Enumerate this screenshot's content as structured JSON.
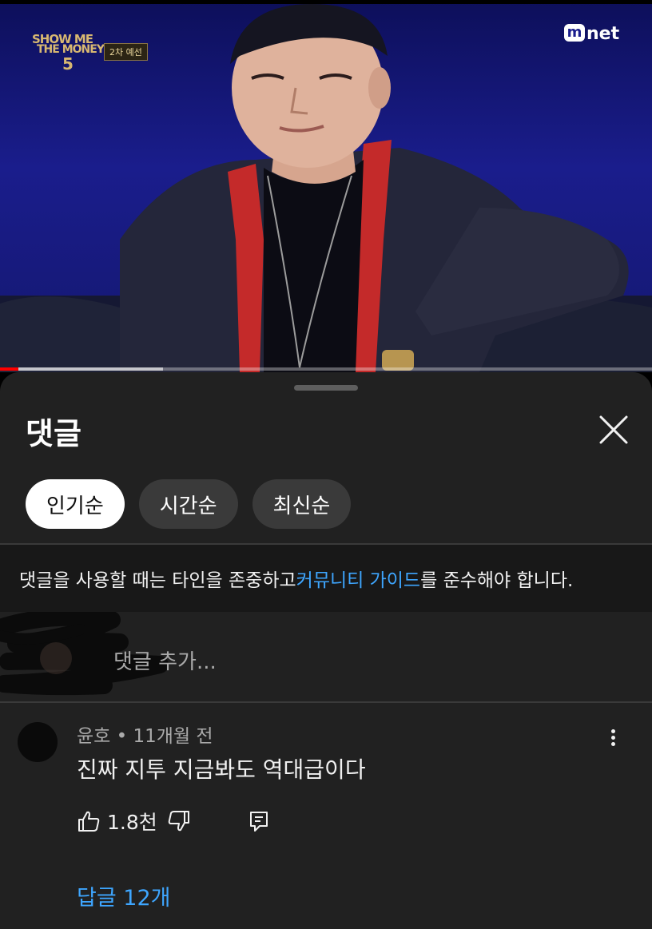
{
  "video": {
    "show_logo": {
      "line1": "SHOW ME",
      "line2": "THE MONEY",
      "line3": "5",
      "round_tag": "2차 예선"
    },
    "channel_logo": "net",
    "progress_fraction": 0.028,
    "buffer_fraction": 0.25,
    "accent_color": "#ff0000"
  },
  "sheet": {
    "title": "댓글",
    "close_icon": "close-icon",
    "sort_chips": [
      {
        "label": "인기순",
        "active": true
      },
      {
        "label": "시간순",
        "active": false
      },
      {
        "label": "최신순",
        "active": false
      }
    ],
    "guideline": {
      "before": "댓글을 사용할 때는 타인을 존중하고 ",
      "link": "커뮤니티 가이드",
      "after": "를 준수해야 합니다."
    },
    "add_comment_placeholder": "댓글 추가..."
  },
  "comment": {
    "author": "윤호",
    "separator": "•",
    "time": "11개월 전",
    "text": "진짜 지투 지금봐도 역대급이다",
    "likes": "1.8천",
    "replies_label": "답글 12개",
    "link_color": "#3ea6ff"
  }
}
